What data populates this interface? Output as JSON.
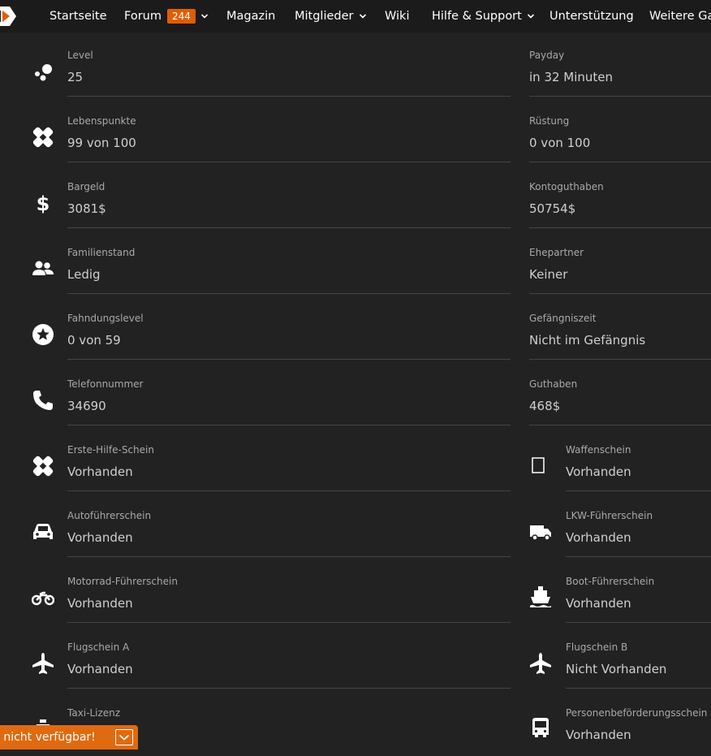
{
  "nav": {
    "items": [
      {
        "label": "Startseite"
      },
      {
        "label": "Forum",
        "badge": "244"
      },
      {
        "label": "Magazin"
      },
      {
        "label": "Mitglieder"
      },
      {
        "label": "Wiki"
      },
      {
        "label": "Hilfe & Support"
      },
      {
        "label": "Unterstützung"
      },
      {
        "label": "Weitere Gar"
      }
    ]
  },
  "left": [
    {
      "label": "Level",
      "value": "25",
      "icon": "bubbles-icon"
    },
    {
      "label": "Lebenspunkte",
      "value": "99 von 100",
      "icon": "bandage-icon"
    },
    {
      "label": "Bargeld",
      "value": "3081$",
      "icon": "dollar-icon"
    },
    {
      "label": "Familienstand",
      "value": "Ledig",
      "icon": "users-icon"
    },
    {
      "label": "Fahndungslevel",
      "value": "0 von 59",
      "icon": "star-circle-icon"
    },
    {
      "label": "Telefonnummer",
      "value": "34690",
      "icon": "phone-icon"
    },
    {
      "label": "Erste-Hilfe-Schein",
      "value": "Vorhanden",
      "icon": "bandage-icon"
    },
    {
      "label": "Autoführerschein",
      "value": "Vorhanden",
      "icon": "car-icon"
    },
    {
      "label": "Motorrad-Führerschein",
      "value": "Vorhanden",
      "icon": "motorcycle-icon"
    },
    {
      "label": "Flugschein A",
      "value": "Vorhanden",
      "icon": "plane-icon"
    },
    {
      "label": "Taxi-Lizenz",
      "value": "",
      "icon": "taxi-icon"
    }
  ],
  "right": [
    {
      "label": "Payday",
      "value": "in 32 Minuten"
    },
    {
      "label": "Rüstung",
      "value": "0 von 100"
    },
    {
      "label": "Kontoguthaben",
      "value": "50754$"
    },
    {
      "label": "Ehepartner",
      "value": "Keiner"
    },
    {
      "label": "Gefängniszeit",
      "value": "Nicht im Gefängnis"
    },
    {
      "label": "Guthaben",
      "value": "468$"
    },
    {
      "label": "Waffenschein",
      "value": "Vorhanden",
      "icon": "square-icon"
    },
    {
      "label": "LKW-Führerschein",
      "value": "Vorhanden",
      "icon": "truck-icon"
    },
    {
      "label": "Boot-Führerschein",
      "value": "Vorhanden",
      "icon": "ship-icon"
    },
    {
      "label": "Flugschein B",
      "value": "Nicht Vorhanden",
      "icon": "plane-icon"
    },
    {
      "label": "Personenbeförderungsschein",
      "value": "Vorhanden",
      "icon": "bus-icon"
    }
  ],
  "toast": {
    "text": "l nicht verfügbar!"
  },
  "colors": {
    "accent": "#e05d00",
    "background": "#222222",
    "nav": "#1b1b1b"
  }
}
